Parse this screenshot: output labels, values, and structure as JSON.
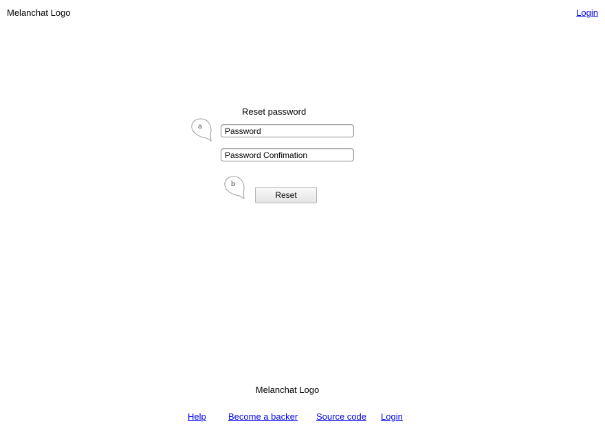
{
  "header": {
    "logo_text": "Melanchat Logo",
    "login_link": "Login"
  },
  "form": {
    "title": "Reset password",
    "password_placeholder": "Password",
    "confirm_placeholder": "Password Confimation",
    "reset_label": "Reset"
  },
  "annotations": {
    "a": "a",
    "b": "b"
  },
  "footer": {
    "logo_text": "Melanchat Logo",
    "links": [
      {
        "label": "Help"
      },
      {
        "label": "Become a backer"
      },
      {
        "label": "Source code"
      },
      {
        "label": "Login"
      }
    ]
  },
  "colors": {
    "link": "#0000ee",
    "text": "#000000",
    "background": "#ffffff"
  }
}
